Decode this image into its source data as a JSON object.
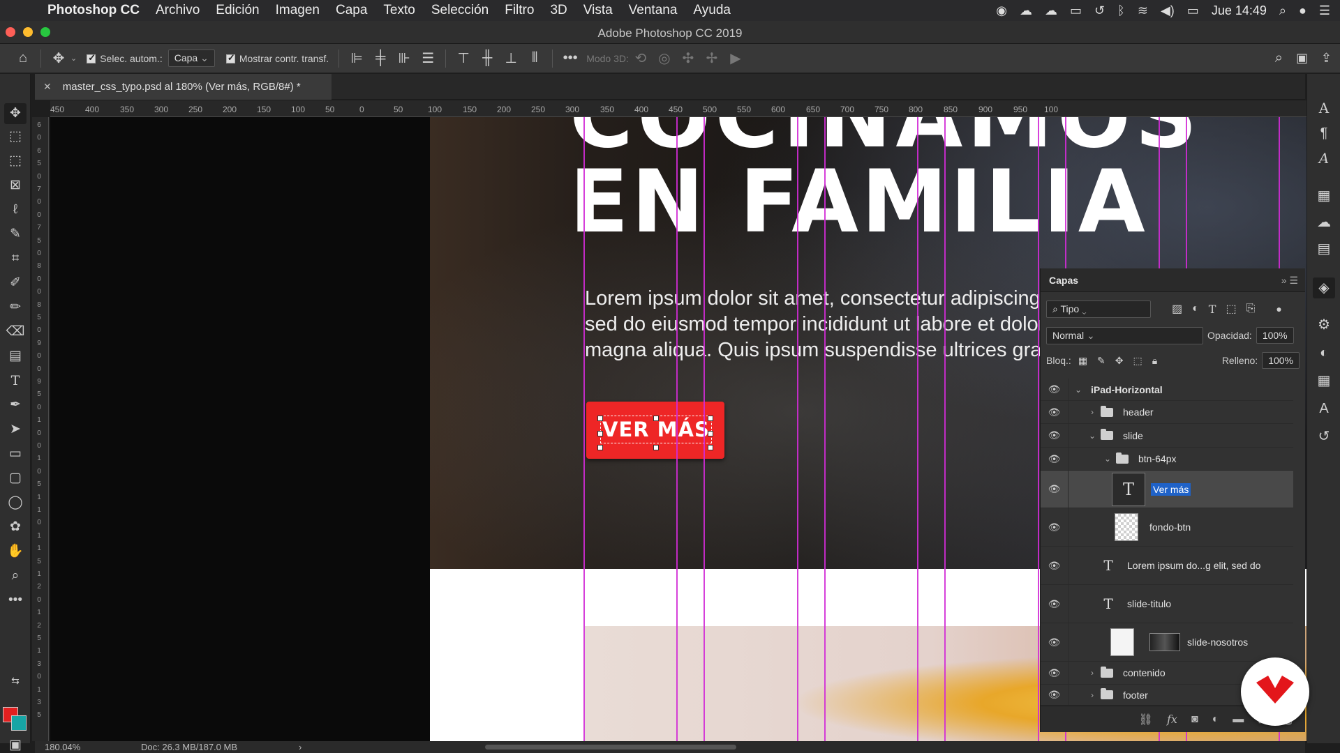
{
  "menubar": {
    "app_name": "Photoshop CC",
    "items": [
      "Archivo",
      "Edición",
      "Imagen",
      "Capa",
      "Texto",
      "Selección",
      "Filtro",
      "3D",
      "Vista",
      "Ventana",
      "Ayuda"
    ],
    "clock": "Jue 14:49",
    "status_icons": [
      "record-icon",
      "creative-cloud-icon",
      "cloud-icon",
      "display-icon",
      "time-machine-icon",
      "bluetooth-icon",
      "wifi-icon",
      "volume-icon",
      "battery-icon",
      "search-icon",
      "siri-icon",
      "notification-center-icon"
    ]
  },
  "window": {
    "title": "Adobe Photoshop CC 2019"
  },
  "options_bar": {
    "auto_select_label": "Selec. autom.:",
    "auto_select_value": "Capa",
    "show_transform_label": "Mostrar contr. transf.",
    "mode_3d_label": "Modo 3D:"
  },
  "document_tab": {
    "label": "master_css_typo.psd al 180% (Ver más, RGB/8#) *"
  },
  "ruler_h": [
    "450",
    "400",
    "350",
    "300",
    "250",
    "200",
    "150",
    "100",
    "50",
    "0",
    "50",
    "100",
    "150",
    "200",
    "250",
    "300",
    "350",
    "400",
    "450",
    "500",
    "550",
    "600",
    "650",
    "700",
    "750",
    "800",
    "850",
    "900",
    "950",
    "100"
  ],
  "ruler_v": [
    "6",
    "0",
    "6",
    "5",
    "0",
    "7",
    "0",
    "0",
    "7",
    "5",
    "0",
    "8",
    "0",
    "0",
    "8",
    "5",
    "0",
    "9",
    "0",
    "0",
    "9",
    "5",
    "0",
    "1",
    "0",
    "0",
    "1",
    "0",
    "5",
    "1",
    "1",
    "0",
    "1",
    "1",
    "5",
    "1",
    "2",
    "0",
    "1",
    "2",
    "5",
    "1",
    "3",
    "0",
    "1",
    "3",
    "5"
  ],
  "canvas": {
    "hero_title_top": "COCINAMOS",
    "hero_title": "EN FAMILIA",
    "hero_text": "Lorem ipsum dolor sit amet, consectetur adipiscing elit,\nsed do eiusmod tempor incididunt ut labore et dolore\nmagna aliqua. Quis ipsum suspendisse ultrices gravida.",
    "cta_label": "VER MÁS"
  },
  "layers_panel": {
    "title": "Capas",
    "filter_kind": "Tipo",
    "blend_mode": "Normal",
    "opacity_label": "Opacidad:",
    "opacity_value": "100%",
    "lock_label": "Bloq.:",
    "fill_label": "Relleno:",
    "fill_value": "100%",
    "layers": [
      {
        "name": "iPad-Horizontal",
        "kind": "artboard"
      },
      {
        "name": "header",
        "kind": "group"
      },
      {
        "name": "slide",
        "kind": "group"
      },
      {
        "name": "btn-64px",
        "kind": "group"
      },
      {
        "name": "Ver más",
        "kind": "text",
        "selected": true
      },
      {
        "name": "fondo-btn",
        "kind": "shape"
      },
      {
        "name": "Lorem ipsum do...g elit, sed do",
        "kind": "text"
      },
      {
        "name": "slide-titulo",
        "kind": "text"
      },
      {
        "name": "slide-nosotros",
        "kind": "smart-object"
      },
      {
        "name": "contenido",
        "kind": "group"
      },
      {
        "name": "footer",
        "kind": "group"
      }
    ]
  },
  "status_bar": {
    "zoom": "180.04%",
    "doc_size": "Doc: 26.3 MB/187.0 MB"
  },
  "colors": {
    "foreground": "#e32020",
    "background": "#17a5a5",
    "cta": "#ee2626",
    "guides": "#d12bd6",
    "selection": "#1f62c8"
  }
}
